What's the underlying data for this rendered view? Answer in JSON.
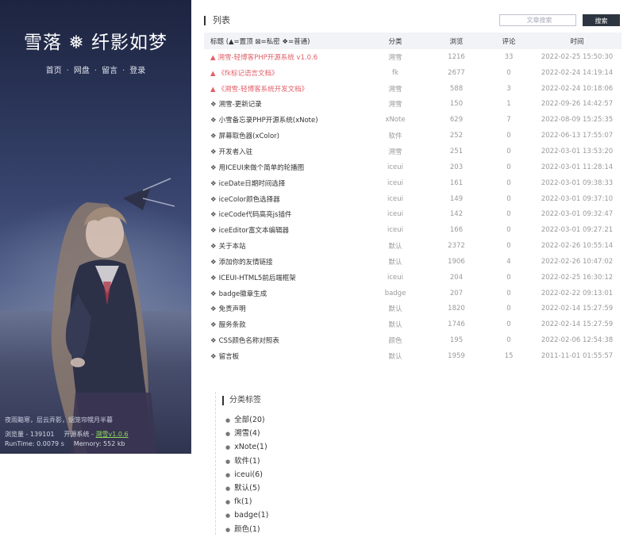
{
  "site": {
    "title": "雪落 ❅ 纤影如梦",
    "nav": [
      "首页",
      "网盘",
      "留言",
      "登录"
    ],
    "slogan": "夜雨黯寒，层云弄影，烟笼帘幌月半暮",
    "visits_label": "浏览量 - 139101",
    "system_label": "开源系统 - ",
    "system_link": "溯雪v1.0.6",
    "runtime_label": "RunTime: 0.0079 s",
    "memory_label": "Memory: 552 kb"
  },
  "list": {
    "section_title": "列表",
    "search_placeholder": "文章搜索",
    "search_button": "搜索",
    "columns": {
      "title": "标题 (▲=置顶 ⊠=私密 ❖=普通)",
      "category": "分类",
      "views": "浏览",
      "comments": "评论",
      "time": "时间"
    },
    "rows": [
      {
        "mark": "▲",
        "pinned": true,
        "title": "溯雪-轻博客PHP开源系统 v1.0.6",
        "category": "溯雪",
        "views": "1216",
        "comments": "33",
        "time": "2022-02-25 15:50:30"
      },
      {
        "mark": "▲",
        "pinned": true,
        "title": "《fk标记语言文档》",
        "category": "fk",
        "views": "2677",
        "comments": "0",
        "time": "2022-02-24 14:19:14"
      },
      {
        "mark": "▲",
        "pinned": true,
        "title": "《溯雪-轻博客系统开发文档》",
        "category": "溯雪",
        "views": "588",
        "comments": "3",
        "time": "2022-02-24 10:18:06"
      },
      {
        "mark": "❖",
        "pinned": false,
        "title": "溯雪-更新记录",
        "category": "溯雪",
        "views": "150",
        "comments": "1",
        "time": "2022-09-26 14:42:57"
      },
      {
        "mark": "❖",
        "pinned": false,
        "title": "小雪备忘录PHP开源系统(xNote)",
        "category": "xNote",
        "views": "629",
        "comments": "7",
        "time": "2022-08-09 15:25:35"
      },
      {
        "mark": "❖",
        "pinned": false,
        "title": "屏幕取色器(xColor)",
        "category": "软件",
        "views": "252",
        "comments": "0",
        "time": "2022-06-13 17:55:07"
      },
      {
        "mark": "❖",
        "pinned": false,
        "title": "开发者入驻",
        "category": "溯雪",
        "views": "251",
        "comments": "0",
        "time": "2022-03-01 13:53:20"
      },
      {
        "mark": "❖",
        "pinned": false,
        "title": "用ICEUI来做个简单的轮播图",
        "category": "iceui",
        "views": "203",
        "comments": "0",
        "time": "2022-03-01 11:28:14"
      },
      {
        "mark": "❖",
        "pinned": false,
        "title": "iceDate日期时间选择",
        "category": "iceui",
        "views": "161",
        "comments": "0",
        "time": "2022-03-01 09:38:33"
      },
      {
        "mark": "❖",
        "pinned": false,
        "title": "iceColor颜色选择器",
        "category": "iceui",
        "views": "149",
        "comments": "0",
        "time": "2022-03-01 09:37:10"
      },
      {
        "mark": "❖",
        "pinned": false,
        "title": "iceCode代码高亮js插件",
        "category": "iceui",
        "views": "142",
        "comments": "0",
        "time": "2022-03-01 09:32:47"
      },
      {
        "mark": "❖",
        "pinned": false,
        "title": "iceEditor富文本编辑器",
        "category": "iceui",
        "views": "166",
        "comments": "0",
        "time": "2022-03-01 09:27:21"
      },
      {
        "mark": "❖",
        "pinned": false,
        "title": "关于本站",
        "category": "默认",
        "views": "2372",
        "comments": "0",
        "time": "2022-02-26 10:55:14"
      },
      {
        "mark": "❖",
        "pinned": false,
        "title": "添加你的友情链接",
        "category": "默认",
        "views": "1906",
        "comments": "4",
        "time": "2022-02-26 10:47:02"
      },
      {
        "mark": "❖",
        "pinned": false,
        "title": "ICEUI-HTML5前后端框架",
        "category": "iceui",
        "views": "204",
        "comments": "0",
        "time": "2022-02-25 16:30:12"
      },
      {
        "mark": "❖",
        "pinned": false,
        "title": "badge徽章生成",
        "category": "badge",
        "views": "207",
        "comments": "0",
        "time": "2022-02-22 09:13:01"
      },
      {
        "mark": "❖",
        "pinned": false,
        "title": "免责声明",
        "category": "默认",
        "views": "1820",
        "comments": "0",
        "time": "2022-02-14 15:27:59"
      },
      {
        "mark": "❖",
        "pinned": false,
        "title": "服务条款",
        "category": "默认",
        "views": "1746",
        "comments": "0",
        "time": "2022-02-14 15:27:59"
      },
      {
        "mark": "❖",
        "pinned": false,
        "title": "CSS颜色名称对照表",
        "category": "颜色",
        "views": "195",
        "comments": "0",
        "time": "2022-02-06 12:54:38"
      },
      {
        "mark": "❖",
        "pinned": false,
        "title": "留言板",
        "category": "默认",
        "views": "1959",
        "comments": "15",
        "time": "2011-11-01 01:55:57"
      }
    ]
  },
  "categories": {
    "section_title": "分类标签",
    "items": [
      "全部(20)",
      "溯雪(4)",
      "xNote(1)",
      "软件(1)",
      "iceui(6)",
      "默认(5)",
      "fk(1)",
      "badge(1)",
      "颜色(1)"
    ]
  },
  "colors": {
    "pinned_title": "#e0606a",
    "button_bg": "#2d3540",
    "header_bg": "#f1f3f6",
    "footer_link": "#8ddb5a"
  }
}
